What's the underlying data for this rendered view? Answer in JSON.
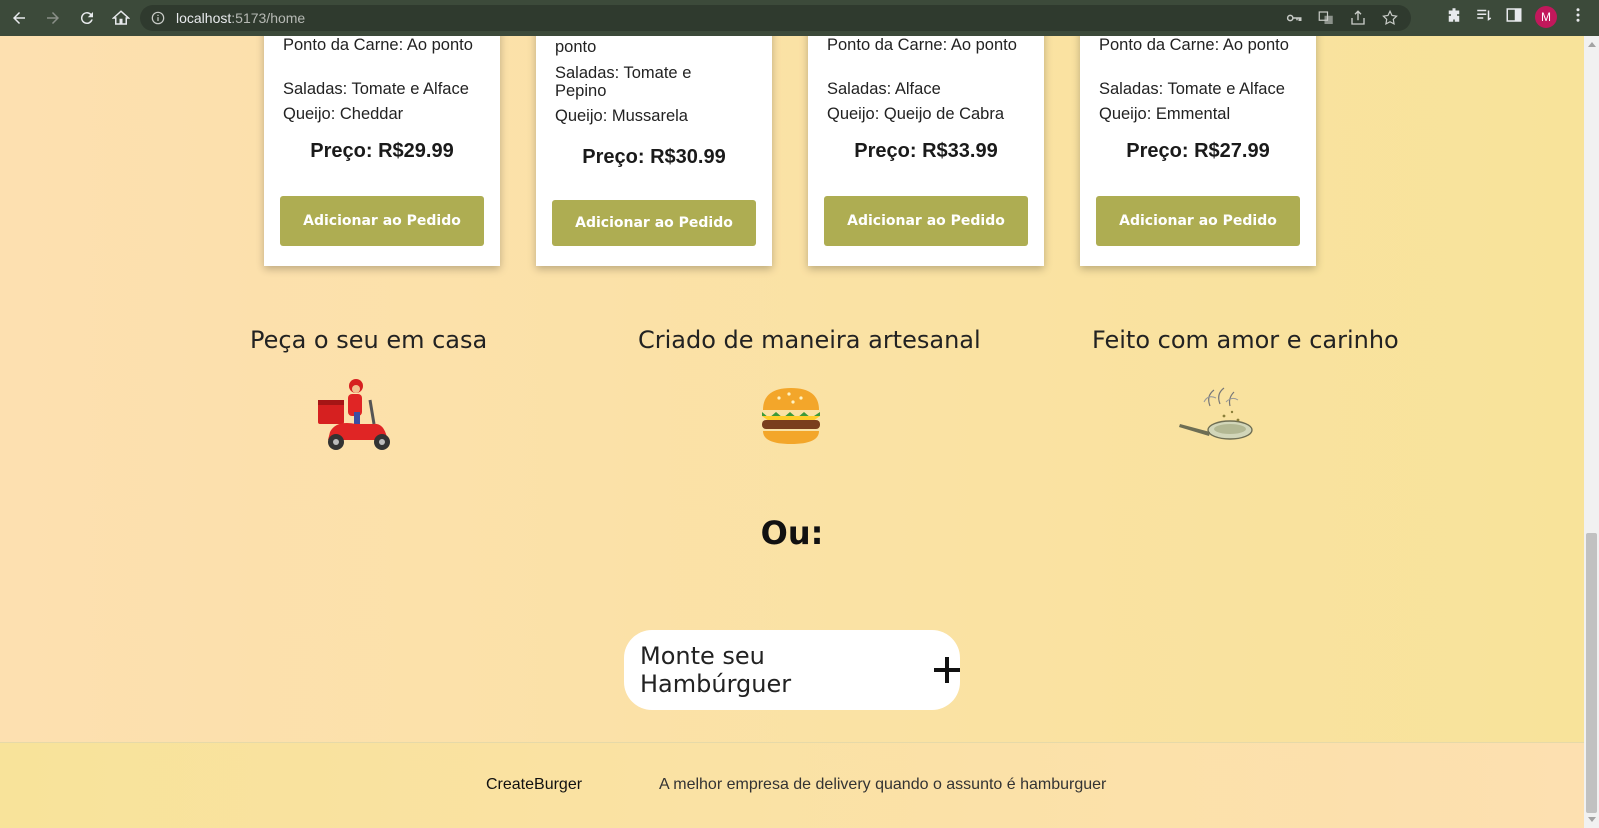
{
  "browser": {
    "url_host": "localhost",
    "url_rest": ":5173/home",
    "profile_initial": "M"
  },
  "cards": [
    {
      "lines": [
        "Ponto da Carne: Ao ponto",
        "Saladas: Tomate e Alface",
        "Queijo: Cheddar"
      ],
      "price": "Preço: R$29.99",
      "button": "Adicionar ao Pedido"
    },
    {
      "lines": [
        "ponto",
        "Saladas: Tomate e Pepino",
        "Queijo: Mussarela"
      ],
      "price": "Preço: R$30.99",
      "button": "Adicionar ao Pedido"
    },
    {
      "lines": [
        "Ponto da Carne: Ao ponto",
        "Saladas: Alface",
        "Queijo: Queijo de Cabra"
      ],
      "price": "Preço: R$33.99",
      "button": "Adicionar ao Pedido"
    },
    {
      "lines": [
        "Ponto da Carne: Ao ponto",
        "Saladas: Tomate e Alface",
        "Queijo: Emmental"
      ],
      "price": "Preço: R$27.99",
      "button": "Adicionar ao Pedido"
    }
  ],
  "features": [
    {
      "title": "Peça o seu em casa",
      "icon": "delivery-scooter-icon"
    },
    {
      "title": "Criado de maneira artesanal",
      "icon": "burger-icon"
    },
    {
      "title": "Feito com amor e carinho",
      "icon": "frying-pan-icon"
    }
  ],
  "or_label": "Ou:",
  "build_button": "Monte seu Hambúrguer",
  "footer": {
    "brand": "CreateBurger",
    "tagline": "A melhor empresa de delivery quando o assunto é hamburguer"
  },
  "colors": {
    "button": "#aead52",
    "page_bg_left": "#fde0b0",
    "page_bg_right": "#f8e39a"
  }
}
